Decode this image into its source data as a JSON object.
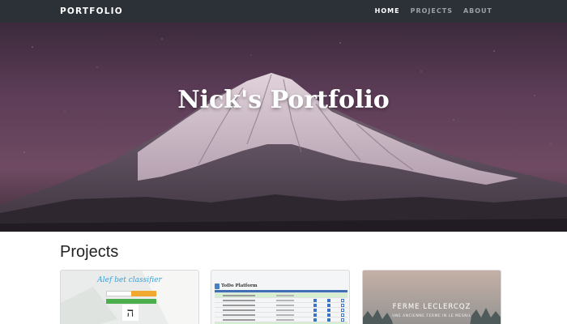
{
  "navbar": {
    "brand": "PORTFOLIO",
    "links": [
      {
        "label": "HOME",
        "active": true
      },
      {
        "label": "PROJECTS",
        "active": false
      },
      {
        "label": "ABOUT",
        "active": false
      }
    ]
  },
  "hero": {
    "title": "Nick's Portfolio"
  },
  "projects": {
    "heading": "Projects",
    "cards": [
      {
        "title": "Alef bet classifier",
        "letter": "ה"
      },
      {
        "title": "ToDo Platform"
      },
      {
        "title": "FERME LECLERCQZ",
        "subtitle": "UNE ANCIENNE FERME IN LE MESNIL"
      }
    ]
  },
  "colors": {
    "navbar_bg": "#2c3137",
    "nav_active": "#ffffff",
    "nav_inactive": "#9aa0a6"
  }
}
